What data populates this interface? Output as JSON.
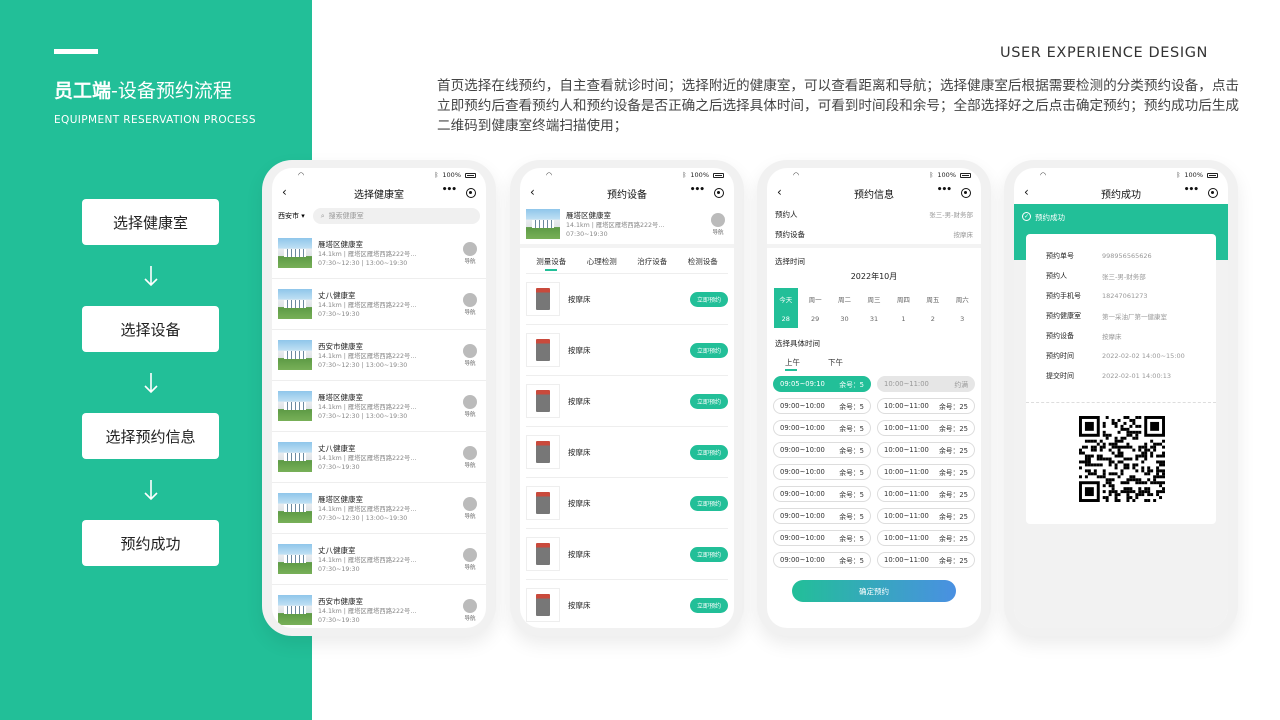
{
  "header": {
    "title_bold": "员工端",
    "title_rest": "-设备预约流程",
    "subtitle": "EQUIPMENT RESERVATION PROCESS",
    "ux_label": "USER EXPERIENCE DESIGN",
    "description": "首页选择在线预约，自主查看就诊时间；选择附近的健康室，可以查看距离和导航；选择健康室后根据需要检测的分类预约设备，点击立即预约后查看预约人和预约设备是否正确之后选择具体时间，可看到时间段和余号；全部选择好之后点击确定预约；预约成功后生成二维码到健康室终端扫描使用；"
  },
  "steps": [
    "选择健康室",
    "选择设备",
    "选择预约信息",
    "预约成功"
  ],
  "colors": {
    "accent": "#22bf98",
    "gradient_end": "#4a90e2"
  },
  "status": {
    "battery": "100%"
  },
  "phone1": {
    "title": "选择健康室",
    "city": "西安市",
    "search_placeholder": "搜索健康室",
    "nav_label": "导航",
    "items": [
      {
        "name": "雁塔区健康室",
        "addr": "14.1km | 雁塔区雁塔西路222号...",
        "hours": "07:30~12:30 | 13:00~19:30"
      },
      {
        "name": "丈八健康室",
        "addr": "14.1km | 雁塔区雁塔西路222号...",
        "hours": "07:30~19:30"
      },
      {
        "name": "西安市健康室",
        "addr": "14.1km | 雁塔区雁塔西路222号...",
        "hours": "07:30~12:30 | 13:00~19:30"
      },
      {
        "name": "雁塔区健康室",
        "addr": "14.1km | 雁塔区雁塔西路222号...",
        "hours": "07:30~12:30 | 13:00~19:30"
      },
      {
        "name": "丈八健康室",
        "addr": "14.1km | 雁塔区雁塔西路222号...",
        "hours": "07:30~19:30"
      },
      {
        "name": "雁塔区健康室",
        "addr": "14.1km | 雁塔区雁塔西路222号...",
        "hours": "07:30~12:30 | 13:00~19:30"
      },
      {
        "name": "丈八健康室",
        "addr": "14.1km | 雁塔区雁塔西路222号...",
        "hours": "07:30~19:30"
      },
      {
        "name": "西安市健康室",
        "addr": "14.1km | 雁塔区雁塔西路222号...",
        "hours": "07:30~19:30"
      }
    ]
  },
  "phone2": {
    "title": "预约设备",
    "room": {
      "name": "雁塔区健康室",
      "addr": "14.1km | 雁塔区雁塔西路222号...",
      "hours": "07:30~19:30"
    },
    "nav_label": "导航",
    "tabs": [
      "测量设备",
      "心理检测",
      "治疗设备",
      "检测设备"
    ],
    "book_label": "立即预约",
    "devices": [
      "按摩床",
      "按摩床",
      "按摩床",
      "按摩床",
      "按摩床",
      "按摩床",
      "按摩床"
    ]
  },
  "phone3": {
    "title": "预约信息",
    "person_label": "预约人",
    "person_value": "张三-男-财务部",
    "device_label": "预约设备",
    "device_value": "按摩床",
    "time_section": "选择时间",
    "month": "2022年10月",
    "days": [
      {
        "w": "今天",
        "d": "28"
      },
      {
        "w": "周一",
        "d": "29"
      },
      {
        "w": "周二",
        "d": "30"
      },
      {
        "w": "周三",
        "d": "31"
      },
      {
        "w": "周四",
        "d": "1"
      },
      {
        "w": "周五",
        "d": "2"
      },
      {
        "w": "周六",
        "d": "3"
      }
    ],
    "detail_section": "选择具体时间",
    "am": "上午",
    "pm": "下午",
    "slots": [
      {
        "t": "09:05~09:10",
        "r": "余号：5",
        "state": "sel"
      },
      {
        "t": "10:00~11:00",
        "r": "约满",
        "state": "full"
      },
      {
        "t": "09:00~10:00",
        "r": "余号：5"
      },
      {
        "t": "10:00~11:00",
        "r": "余号：25"
      },
      {
        "t": "09:00~10:00",
        "r": "余号：5"
      },
      {
        "t": "10:00~11:00",
        "r": "余号：25"
      },
      {
        "t": "09:00~10:00",
        "r": "余号：5"
      },
      {
        "t": "10:00~11:00",
        "r": "余号：25"
      },
      {
        "t": "09:00~10:00",
        "r": "余号：5"
      },
      {
        "t": "10:00~11:00",
        "r": "余号：25"
      },
      {
        "t": "09:00~10:00",
        "r": "余号：5"
      },
      {
        "t": "10:00~11:00",
        "r": "余号：25"
      },
      {
        "t": "09:00~10:00",
        "r": "余号：5"
      },
      {
        "t": "10:00~11:00",
        "r": "余号：25"
      },
      {
        "t": "09:00~10:00",
        "r": "余号：5"
      },
      {
        "t": "10:00~11:00",
        "r": "余号：25"
      },
      {
        "t": "09:00~10:00",
        "r": "余号：5"
      },
      {
        "t": "10:00~11:00",
        "r": "余号：25"
      }
    ],
    "confirm": "确定预约"
  },
  "phone4": {
    "title": "预约成功",
    "banner": "预约成功",
    "rows": [
      {
        "k": "预约单号",
        "v": "998956565626"
      },
      {
        "k": "预约人",
        "v": "张三-男-财务部"
      },
      {
        "k": "预约手机号",
        "v": "18247061273"
      },
      {
        "k": "预约健康室",
        "v": "第一采油厂第一健康室"
      },
      {
        "k": "预约设备",
        "v": "按摩床"
      },
      {
        "k": "预约时间",
        "v": "2022-02-02  14:00~15:00"
      },
      {
        "k": "提交时间",
        "v": "2022-02-01  14:00:13"
      }
    ]
  }
}
